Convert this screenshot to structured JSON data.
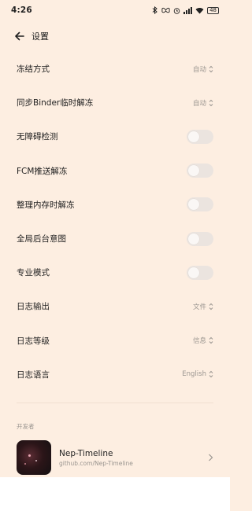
{
  "status_bar": {
    "time": "4:26",
    "battery": "48"
  },
  "header": {
    "title": "设置"
  },
  "settings": [
    {
      "label": "冻结方式",
      "type": "select",
      "value": "自动"
    },
    {
      "label": "同步Binder临时解冻",
      "type": "select",
      "value": "自动"
    },
    {
      "label": "无障碍检测",
      "type": "toggle",
      "on": false
    },
    {
      "label": "FCM推送解冻",
      "type": "toggle",
      "on": false
    },
    {
      "label": "整理内存时解冻",
      "type": "toggle",
      "on": false
    },
    {
      "label": "全局后台意图",
      "type": "toggle",
      "on": false
    },
    {
      "label": "专业模式",
      "type": "toggle",
      "on": false
    },
    {
      "label": "日志输出",
      "type": "select",
      "value": "文件"
    },
    {
      "label": "日志等级",
      "type": "select",
      "value": "信息"
    },
    {
      "label": "日志语言",
      "type": "select",
      "value": "English"
    }
  ],
  "developer": {
    "section_label": "开发者",
    "name": "Nep-Timeline",
    "url": "github.com/Nep-Timeline"
  },
  "colors": {
    "background": "#fdeee1",
    "toggle_off": "#ebe4df",
    "secondary_text": "#9a9590"
  }
}
